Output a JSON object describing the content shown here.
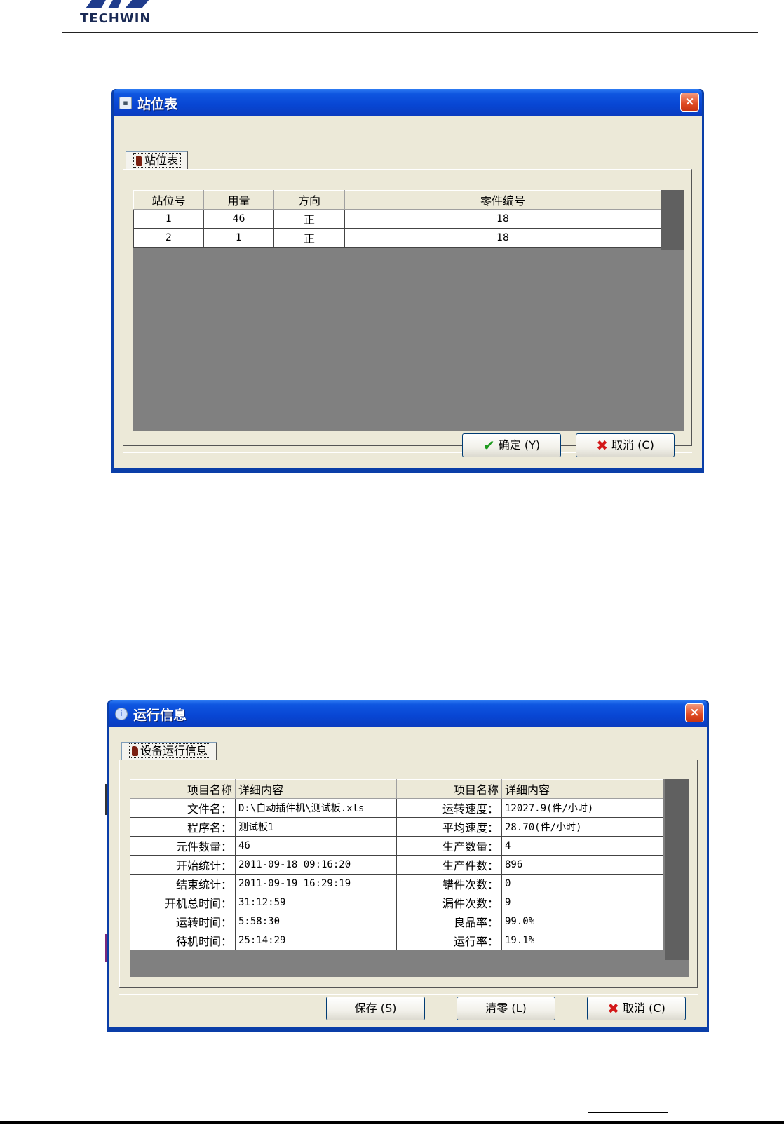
{
  "page": {
    "logo_text": "TECHWIN"
  },
  "station_window": {
    "title": "站位表",
    "close": "×",
    "tab_label": "站位表",
    "columns": [
      "站位号",
      "用量",
      "方向",
      "零件编号"
    ],
    "rows": [
      [
        "1",
        "46",
        "正",
        "18"
      ],
      [
        "2",
        "1",
        "正",
        "18"
      ]
    ],
    "ok_label": "确定",
    "ok_key": "(Y)",
    "cancel_label": "取消",
    "cancel_key": "(C)"
  },
  "run_window": {
    "title": "运行信息",
    "close": "×",
    "tab_label": "设备运行信息",
    "columns": [
      "项目名称",
      "详细内容",
      "项目名称",
      "详细内容"
    ],
    "rows": [
      [
        "文件名：",
        "D:\\自动插件机\\测试板.xls",
        "运转速度：",
        "12027.9(件/小时)"
      ],
      [
        "程序名：",
        "测试板1",
        "平均速度：",
        "28.70(件/小时)"
      ],
      [
        "元件数量：",
        "46",
        "生产数量：",
        "4"
      ],
      [
        "开始统计：",
        "2011-09-18  09:16:20",
        "生产件数：",
        "896"
      ],
      [
        "结束统计：",
        "2011-09-19  16:29:19",
        "错件次数：",
        "0"
      ],
      [
        "开机总时间：",
        "31:12:59",
        "漏件次数：",
        "9"
      ],
      [
        "运转时间：",
        "5:58:30",
        "良品率：",
        "99.0%"
      ],
      [
        "待机时间：",
        "25:14:29",
        "运行率：",
        "19.1%"
      ]
    ],
    "save_label": "保存",
    "save_key": "(S)",
    "clear_label": "清零",
    "clear_key": "(L)",
    "cancel_label": "取消",
    "cancel_key": "(C)"
  }
}
